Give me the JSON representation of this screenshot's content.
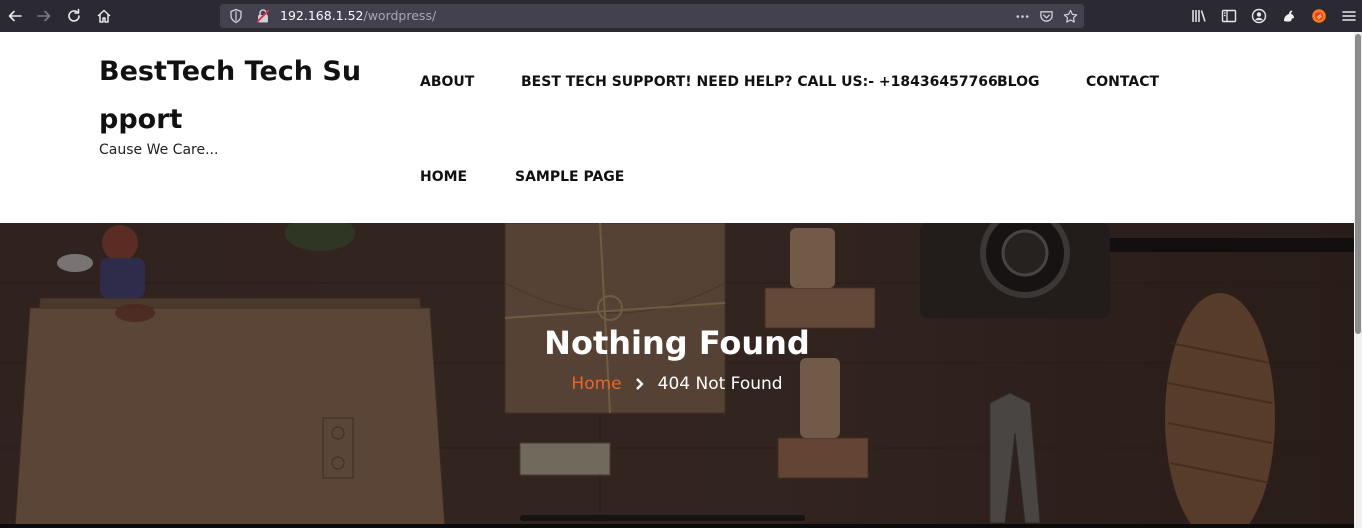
{
  "browser": {
    "url_host": "192.168.1.52",
    "url_path": "/wordpress/",
    "colors": {
      "toolbar_bg": "#2b2a33",
      "urlbar_bg": "#42414d"
    },
    "icons": [
      "back-icon",
      "forward-icon",
      "reload-icon",
      "home-icon",
      "shield-icon",
      "insecure-lock-icon",
      "more-icon",
      "pocket-icon",
      "bookmark-star-icon",
      "library-icon",
      "sidebar-icon",
      "account-icon",
      "extension-icon",
      "firefox-addon-icon",
      "menu-icon"
    ]
  },
  "site": {
    "title": "BestTech Tech Support",
    "tagline": "Cause We Care...",
    "nav": [
      {
        "label": "ABOUT"
      },
      {
        "label": "BEST TECH SUPPORT! NEED HELP? CALL US:- +18436457766"
      },
      {
        "label": "BLOG"
      },
      {
        "label": "CONTACT"
      },
      {
        "label": "HOME"
      },
      {
        "label": "SAMPLE PAGE"
      }
    ]
  },
  "hero": {
    "title": "Nothing Found",
    "breadcrumb": {
      "home": "Home",
      "current": "404 Not Found"
    },
    "colors": {
      "accent": "#e8672a",
      "text": "#ffffff"
    }
  }
}
